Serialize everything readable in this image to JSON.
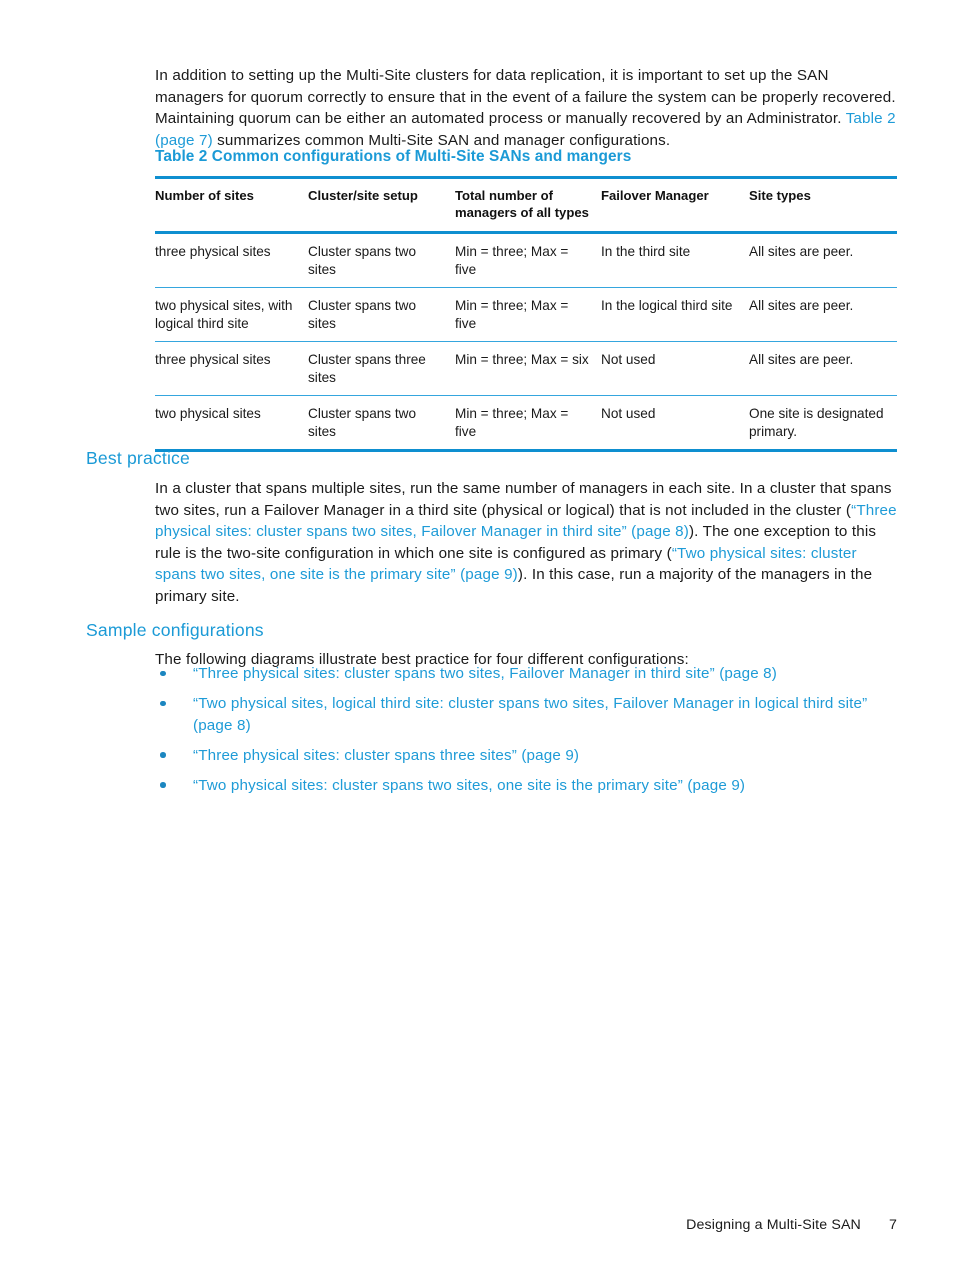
{
  "intro": {
    "text_before_link": "In addition to setting up the Multi-Site clusters for data replication, it is important to set up the SAN managers for quorum correctly to ensure that in the event of a failure the system can be properly recovered. Maintaining quorum can be either an automated process or manually recovered by an Administrator. ",
    "link": "Table 2 (page 7)",
    "text_after_link": " summarizes common Multi-Site SAN and manager configurations."
  },
  "table": {
    "caption": "Table 2 Common configurations of Multi-Site SANs and mangers",
    "headers": [
      "Number of sites",
      "Cluster/site setup",
      "Total number of managers of all types",
      "Failover Manager",
      "Site types"
    ],
    "rows": [
      [
        "three physical sites",
        "Cluster spans two sites",
        "Min = three; Max = five",
        "In the third site",
        "All sites are peer."
      ],
      [
        "two physical sites, with logical third site",
        "Cluster spans two sites",
        "Min = three; Max = five",
        "In the logical third site",
        "All sites are peer."
      ],
      [
        "three physical sites",
        "Cluster spans three sites",
        "Min = three; Max = six",
        "Not used",
        "All sites are peer."
      ],
      [
        "two physical sites",
        "Cluster spans two sites",
        "Min = three; Max = five",
        "Not used",
        "One site is designated primary."
      ]
    ]
  },
  "best_practice": {
    "heading": "Best practice",
    "seg1": "In a cluster that spans multiple sites, run the same number of managers in each site. In a cluster that spans two sites, run a Failover Manager in a third site (physical or logical) that is not included in the cluster (",
    "link1": "“Three physical sites: cluster spans two sites, Failover Manager in third site” (page 8)",
    "seg2": "). The one exception to this rule is the two-site configuration in which one site is configured as primary (",
    "link2": "“Two physical sites: cluster spans two sites, one site is the primary site” (page 9)",
    "seg3": "). In this case, run a majority of the managers in the primary site."
  },
  "sample_configurations": {
    "heading": "Sample configurations",
    "intro": "The following diagrams illustrate best practice for four different configurations:",
    "items": [
      "“Three physical sites: cluster spans two sites, Failover Manager in third site” (page 8)",
      "“Two physical sites, logical third site: cluster spans two sites, Failover Manager in logical third site” (page 8)",
      "“Three physical sites: cluster spans three sites” (page 9)",
      "“Two physical sites: cluster spans two sites, one site is the primary site” (page 9)"
    ]
  },
  "footer": {
    "label": "Designing a Multi-Site SAN",
    "page_number": "7"
  },
  "colors": {
    "link_blue": "#1e9bd7",
    "heading_blue": "#1b9ad6",
    "table_rule_blue": "#0e8fd0",
    "table_row_rule_blue": "#35a6de",
    "body_text": "#1a1a1a"
  }
}
